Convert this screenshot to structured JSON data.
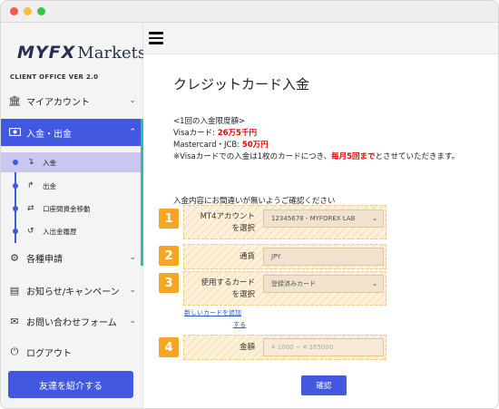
{
  "sidebar": {
    "logo_myfx": "MYFX",
    "logo_markets": "Markets",
    "version": "CLIENT OFFICE VER 2.0",
    "items": [
      {
        "label": "マイアカウント",
        "icon": "bank-icon"
      },
      {
        "label": "入金・出金",
        "icon": "money-icon"
      },
      {
        "label": "各種申請",
        "icon": "gears-icon"
      },
      {
        "label": "お知らせ/キャンペーン",
        "icon": "newspaper-icon"
      },
      {
        "label": "お問い合わせフォーム",
        "icon": "envelope-icon"
      },
      {
        "label": "ログアウト",
        "icon": "power-icon"
      }
    ],
    "subitems": [
      {
        "label": "入金",
        "icon": "arrow-down-icon"
      },
      {
        "label": "出金",
        "icon": "arrow-up-icon"
      },
      {
        "label": "口座間資金移動",
        "icon": "transfer-icon"
      },
      {
        "label": "入出金履歴",
        "icon": "history-icon"
      }
    ],
    "refer_button": "友達を紹介する"
  },
  "main": {
    "title": "クレジットカード入金",
    "limits_heading": "<1回の入金限度額>",
    "visa_label": "Visaカード:",
    "visa_limit": "26万5千円",
    "mc_label": "Mastercard・JCB:",
    "mc_limit": "50万円",
    "visa_note_pre": "※Visaカードでの入金は1枚のカードにつき、",
    "visa_note_red": "毎月5回まで",
    "visa_note_post": "とさせていただきます。",
    "confirm_note": "入金内容にお間違いが無いようご確認ください",
    "fields": [
      {
        "step": "1",
        "label_l1": "MT4アカウント",
        "label_l2": "を選択",
        "value": "12345678 - MYFOREX LAB",
        "dropdown": true
      },
      {
        "step": "2",
        "label_l1": "通貨",
        "label_l2": "",
        "value": "JPY",
        "dropdown": false
      },
      {
        "step": "3",
        "label_l1": "使用するカード",
        "label_l2": "を選択",
        "value": "登録済みカード",
        "dropdown": true
      },
      {
        "step": "4",
        "label_l1": "金額",
        "label_l2": "",
        "value": "¥ 1000 ~ ¥ 265000",
        "dropdown": false
      }
    ],
    "add_card_l1": "新しいカードを追加",
    "add_card_l2": "する",
    "confirm_button": "確認"
  },
  "colors": {
    "accent": "#4258e0",
    "step": "#f5a623",
    "teal": "#2bbfa4",
    "red": "#e00000"
  }
}
